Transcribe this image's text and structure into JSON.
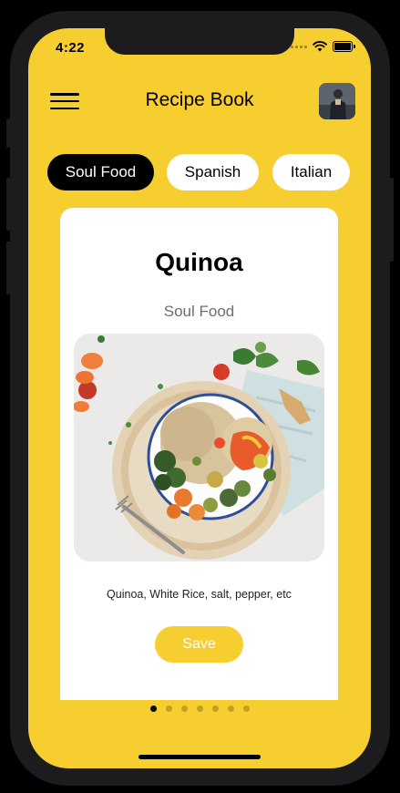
{
  "status": {
    "time": "4:22"
  },
  "header": {
    "title": "Recipe Book"
  },
  "chips": [
    {
      "label": "Soul Food",
      "active": true
    },
    {
      "label": "Spanish",
      "active": false
    },
    {
      "label": "Italian",
      "active": false
    }
  ],
  "card": {
    "title": "Quinoa",
    "category": "Soul Food",
    "ingredients": "Quinoa, White Rice, salt, pepper, etc",
    "save_label": "Save"
  },
  "pager": {
    "count": 7,
    "active_index": 0
  },
  "colors": {
    "accent": "#F7CE2F",
    "chip_active": "#000000",
    "chip_inactive": "#FFFFFF"
  },
  "icons": [
    "menu-icon",
    "wifi-icon",
    "battery-icon",
    "signal-icon"
  ]
}
